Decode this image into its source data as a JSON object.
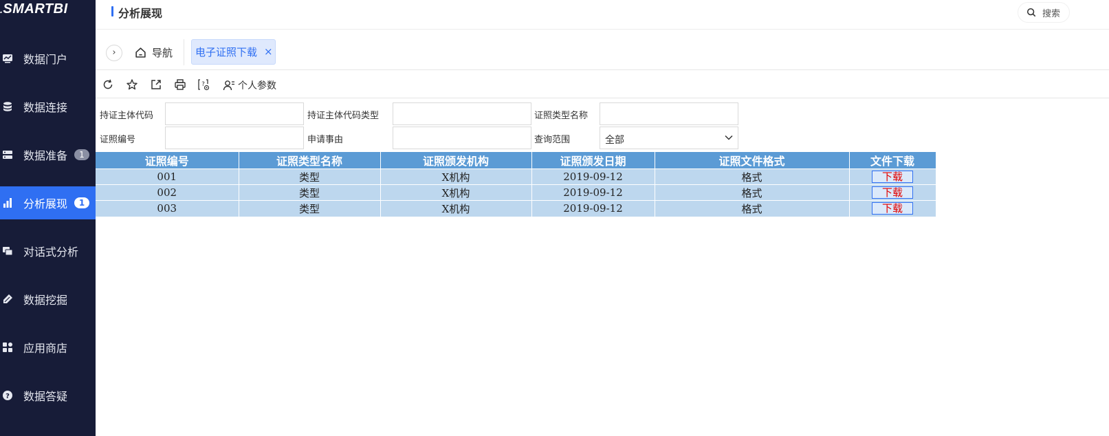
{
  "logo": {
    "text": "SMARTBI"
  },
  "sidebar": {
    "items": [
      {
        "label": "数据门户",
        "icon": "dashboard-icon"
      },
      {
        "label": "数据连接",
        "icon": "database-icon"
      },
      {
        "label": "数据准备",
        "icon": "server-icon",
        "badge": "1"
      },
      {
        "label": "分析展现",
        "icon": "bar-chart-icon",
        "badge": "1",
        "active": true
      },
      {
        "label": "对话式分析",
        "icon": "chat-icon"
      },
      {
        "label": "数据挖掘",
        "icon": "pickaxe-icon"
      },
      {
        "label": "应用商店",
        "icon": "apps-icon"
      },
      {
        "label": "数据答疑",
        "icon": "help-icon"
      }
    ]
  },
  "header": {
    "title": "分析展现",
    "search_label": "搜索"
  },
  "tabs": {
    "nav_label": "导航",
    "active_tab": "电子证照下载",
    "close_glyph": "×",
    "collapse_glyph": "›"
  },
  "toolbar": {
    "personal_params": "个人参数"
  },
  "filters": {
    "holder_code": {
      "label": "持证主体代码",
      "value": ""
    },
    "holder_code_type": {
      "label": "持证主体代码类型",
      "value": ""
    },
    "license_type_name": {
      "label": "证照类型名称",
      "value": ""
    },
    "license_number": {
      "label": "证照编号",
      "value": ""
    },
    "apply_reason": {
      "label": "申请事由",
      "value": ""
    },
    "query_scope": {
      "label": "查询范围",
      "value": "全部"
    }
  },
  "table": {
    "headers": [
      "证照编号",
      "证照类型名称",
      "证照颁发机构",
      "证照颁发日期",
      "证照文件格式",
      "文件下载"
    ],
    "rows": [
      [
        "001",
        "类型",
        "X机构",
        "2019-09-12",
        "格式",
        "下载"
      ],
      [
        "002",
        "类型",
        "X机构",
        "2019-09-12",
        "格式",
        "下载"
      ],
      [
        "003",
        "类型",
        "X机构",
        "2019-09-12",
        "格式",
        "下载"
      ]
    ]
  },
  "colors": {
    "sidebar_bg": "#171c38",
    "accent": "#2f6ff2",
    "table_header": "#5b9bd5",
    "table_row": "#bdd7ee",
    "download_text": "#e00000"
  }
}
